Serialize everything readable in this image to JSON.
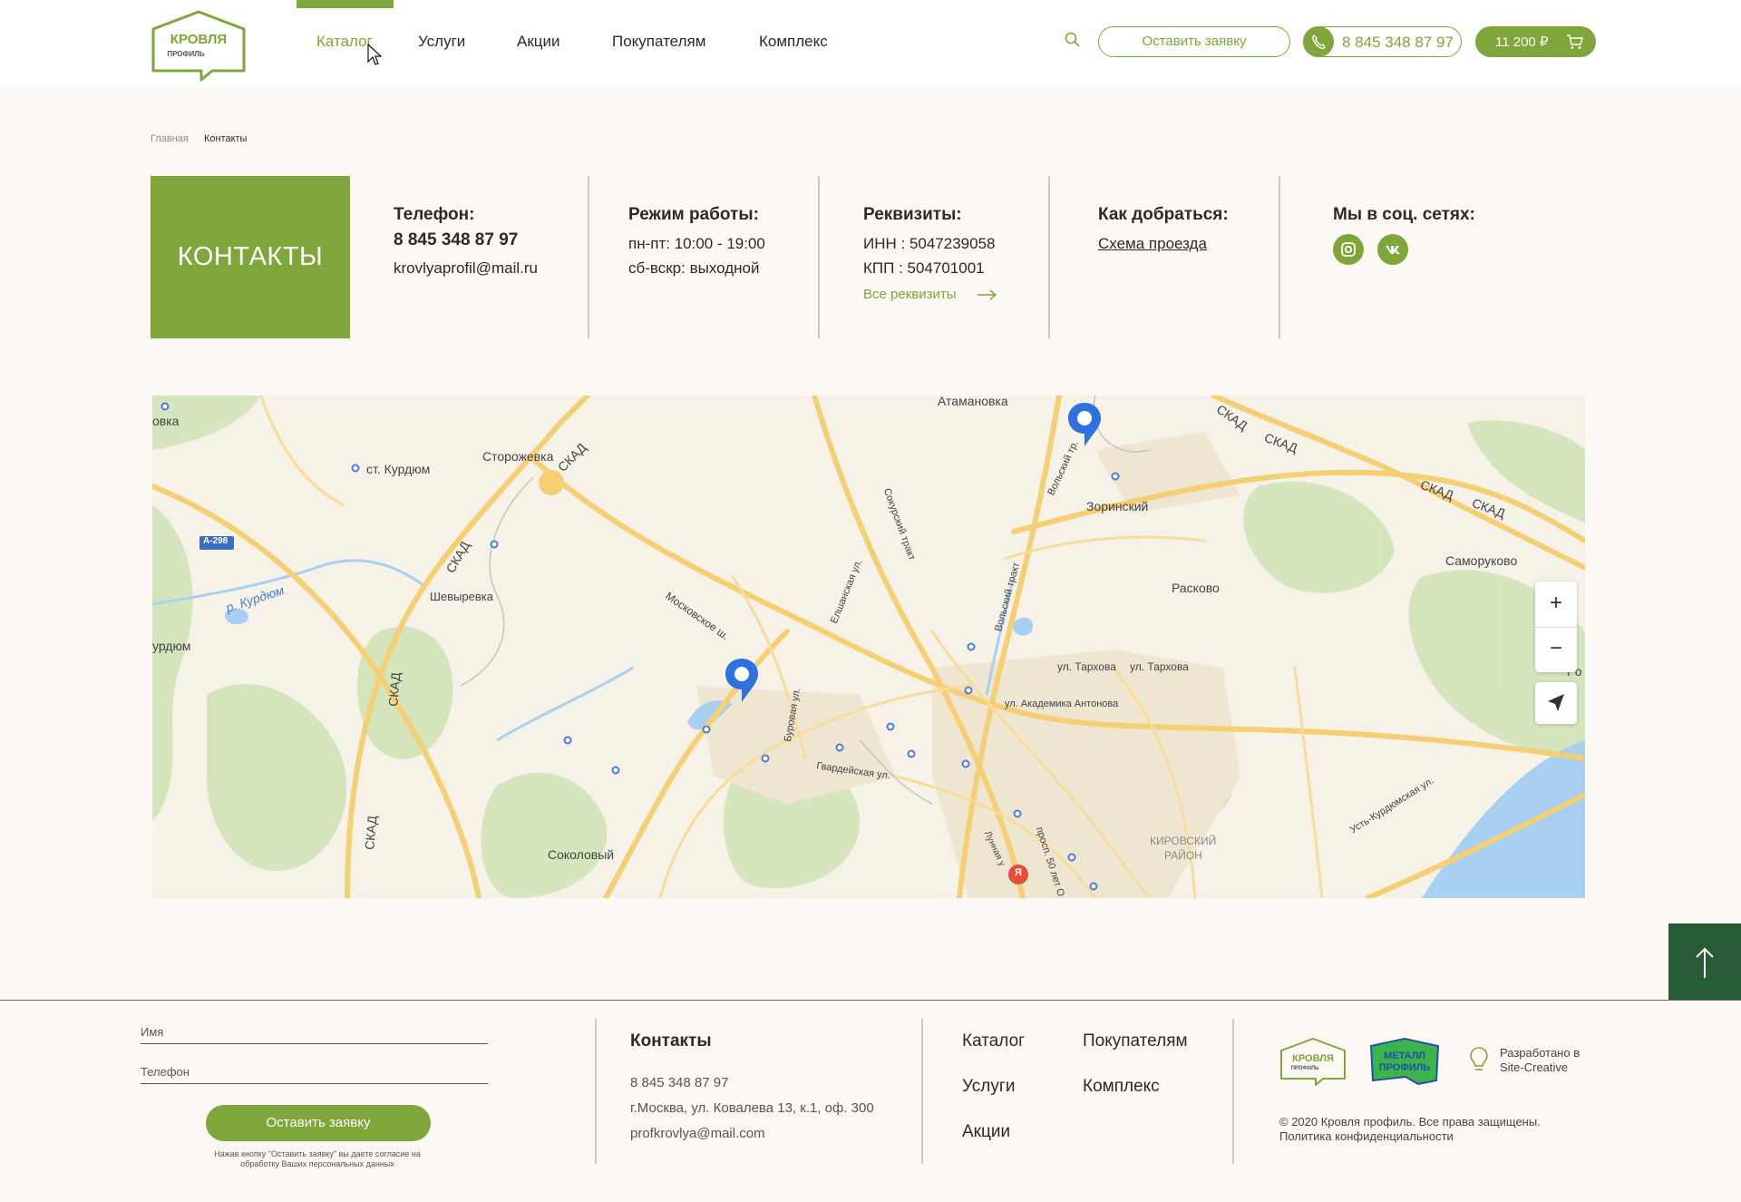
{
  "header": {
    "logo": {
      "line1": "КРОВЛЯ",
      "line2": "ПРОФИЛЬ"
    },
    "nav": [
      {
        "label": "Каталог",
        "active": true
      },
      {
        "label": "Услуги",
        "active": false
      },
      {
        "label": "Акции",
        "active": false
      },
      {
        "label": "Покупателям",
        "active": false
      },
      {
        "label": "Комплекс",
        "active": false
      }
    ],
    "request_label": "Оставить заявку",
    "phone": "8 845 348 87 97",
    "cart_total": "11 200 ₽"
  },
  "breadcrumb": {
    "home": "Главная",
    "current": "Контакты"
  },
  "contacts": {
    "title": "КОНТАКТЫ",
    "phone_title": "Телефон:",
    "phone": "8 845 348 87 97",
    "email": "krovlyaprofil@mail.ru",
    "hours_title": "Режим работы:",
    "hours_weekdays": "пн-пт: 10:00 - 19:00",
    "hours_weekend": "сб-вскр: выходной",
    "requisites_title": "Реквизиты:",
    "inn": "ИНН : 5047239058",
    "kpp": "КПП : 504701001",
    "all_requisites": "Все реквизиты",
    "directions_title": "Как добраться:",
    "directions_link": "Схема проезда",
    "social_title": "Мы в соц. сетях:",
    "social": [
      {
        "icon": "instagram-icon"
      },
      {
        "icon": "vk-icon"
      }
    ]
  },
  "map": {
    "labels": {
      "atamanovka": "Атамановка",
      "kurdyum": "ст. Курдюм",
      "storozhevka": "Сторожевка",
      "skad1": "СКАД",
      "skad2": "СКАД",
      "skad3": "СКАД",
      "skad4": "СКАД",
      "skad5": "СКАД",
      "skad6": "СКАД",
      "skad7": "СКАД",
      "skad8": "СКАД",
      "a298": "А-298",
      "r_kurdyum": "р. Курдюм",
      "urdyum": "урдюм",
      "ovka": "овка",
      "shevyrevka": "Шевыревка",
      "moskovskoe": "Московское ш.",
      "elshanskaya": "Елшанская ул.",
      "sokursky": "Сокурский тракт",
      "volsky": "Вольский тракт",
      "volsky2": "Вольский тр.",
      "zorinsky": "Зоринский",
      "raskovo": "Расково",
      "samorukovo": "Саморуково",
      "tarkhova1": "ул. Тархова",
      "tarkhova2": "ул. Тархова",
      "antonova": "ул. Академика Антонова",
      "burovaya": "Буровая ул.",
      "gvardeyskaya": "Гвардейская ул.",
      "sokolovy": "Соколовый",
      "kirovsky": "КИРОВСКИЙ",
      "rayon": "РАЙОН",
      "prosp50": "просп. 50 лет О",
      "lunnaya": "Лунная у",
      "ust_kurdyum": "Усть-Курдюмская ул.",
      "ro": "Ро"
    },
    "zoom_in": "+",
    "zoom_out": "−",
    "yandex": "Я"
  },
  "footer": {
    "name_label": "Имя",
    "phone_label": "Телефон",
    "submit": "Оставить заявку",
    "note": "Нажав кнопку \"Оставить заявку\" вы даете согласие на обработку Ваших персональных данных",
    "contacts_title": "Контакты",
    "phone": "8 845 348 87 97",
    "address": "г.Москва, ул. Ковалева 13, к.1, оф. 300",
    "email": "profkrovlya@mail.com",
    "nav": {
      "catalog": "Каталог",
      "buyers": "Покупателям",
      "services": "Услуги",
      "complex": "Комплекс",
      "promos": "Акции"
    },
    "logo2": {
      "line1": "МЕТАЛЛ",
      "line2": "ПРОФИЛЬ"
    },
    "dev_line1": "Разработано в",
    "dev_line2": "Site-Creative",
    "copyright": "© 2020 Кровля профиль. Все права защищены.",
    "privacy": "Политика конфиденциальности"
  },
  "colors": {
    "accent": "#7fa63a",
    "dark_green": "#285c37",
    "background": "#fdf8f3"
  }
}
